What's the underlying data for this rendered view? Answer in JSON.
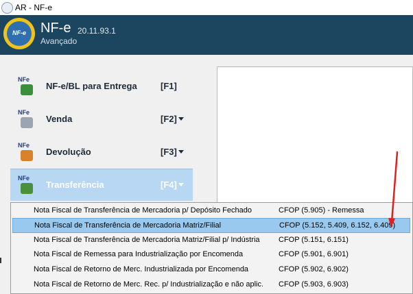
{
  "window": {
    "title": "AR - NF-e"
  },
  "header": {
    "product": "NF-e",
    "version": "20.11.93.1",
    "mode": "Avançado",
    "logo_text": "NF-e"
  },
  "menu": [
    {
      "label": "NF-e/BL para Entrega",
      "key": "[F1]",
      "badge": "NFe",
      "icon": "delivery-icon",
      "color": "#3a8f3a"
    },
    {
      "label": "Venda",
      "key": "[F2]",
      "badge": "NFe",
      "icon": "cart-icon",
      "color": "#9aa5b1"
    },
    {
      "label": "Devolução",
      "key": "[F3]",
      "badge": "NFe",
      "icon": "return-box-icon",
      "color": "#d9822b"
    },
    {
      "label": "Transferência",
      "key": "[F4]",
      "badge": "NFe",
      "icon": "transfer-icon",
      "color": "#4a8f3a"
    }
  ],
  "dropdown": [
    {
      "label": "Nota Fiscal de Transferência de Mercadoria p/ Depósito Fechado",
      "cfop": "CFOP (5.905) - Remessa"
    },
    {
      "label": "Nota Fiscal de Transferência de Mercadoria Matriz/Filial",
      "cfop": "CFOP (5.152, 5.409, 6.152, 6.409)"
    },
    {
      "label": "Nota Fiscal de Transferência de Mercadoria Matriz/Filial p/ Indústria",
      "cfop": "CFOP (5.151, 6.151)"
    },
    {
      "label": "Nota Fiscal de Remessa para Industrialização por Encomenda",
      "cfop": "CFOP (5.901, 6.901)"
    },
    {
      "label": "Nota Fiscal de Retorno de Merc. Industrializada por Encomenda",
      "cfop": "CFOP (5.902, 6.902)"
    },
    {
      "label": "Nota Fiscal de Retorno de Merc. Rec. p/ Industrialização e não aplic.",
      "cfop": "CFOP (5.903, 6.903)"
    }
  ],
  "colors": {
    "header_bg": "#1c4660",
    "selected_menu": "#b7d7f2",
    "highlight_item": "#99c9ef",
    "annotation_arrow": "#e02020"
  }
}
